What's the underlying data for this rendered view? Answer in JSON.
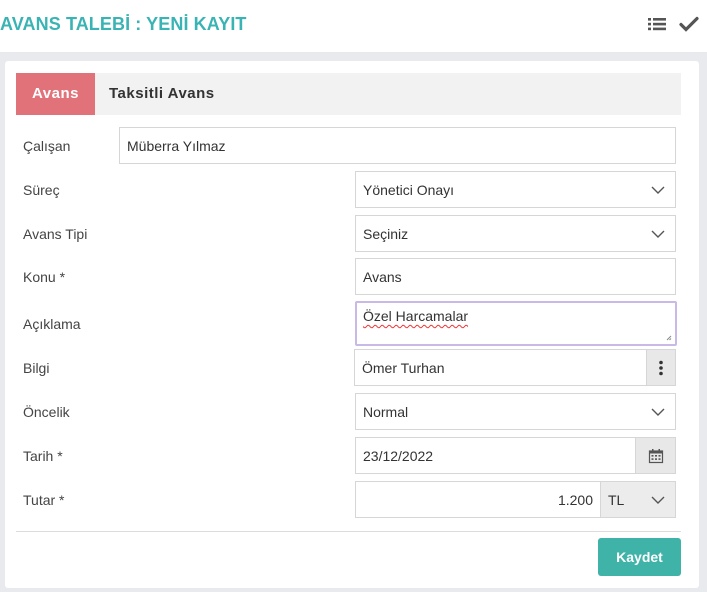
{
  "header": {
    "title": "AVANS TALEBİ : YENİ KAYIT"
  },
  "tabs": [
    {
      "label": "Avans",
      "active": true
    },
    {
      "label": "Taksitli Avans",
      "active": false
    }
  ],
  "form": {
    "employee": {
      "label": "Çalışan",
      "value": "Müberra Yılmaz"
    },
    "process": {
      "label": "Süreç",
      "value": "Yönetici Onayı"
    },
    "advance_type": {
      "label": "Avans Tipi",
      "value": "Seçiniz"
    },
    "subject": {
      "label": "Konu *",
      "value": "Avans"
    },
    "description": {
      "label": "Açıklama",
      "value": "Özel Harcamalar"
    },
    "info": {
      "label": "Bilgi",
      "value": "Ömer Turhan"
    },
    "priority": {
      "label": "Öncelik",
      "value": "Normal"
    },
    "date": {
      "label": "Tarih *",
      "value": "23/12/2022"
    },
    "amount": {
      "label": "Tutar *",
      "value": "1.200",
      "currency": "TL"
    }
  },
  "actions": {
    "save_label": "Kaydet"
  },
  "colors": {
    "accent": "#39b3b3",
    "tab_active": "#e2727a",
    "save": "#3fb3a8"
  },
  "icons": {
    "list": "list-icon",
    "check": "check-icon",
    "more": "kebab-icon",
    "calendar": "calendar-icon",
    "chevron": "chevron-down-icon"
  }
}
